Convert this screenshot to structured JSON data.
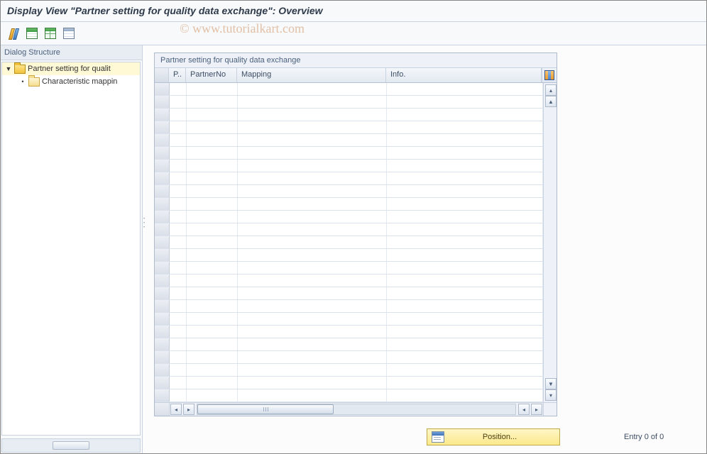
{
  "title": "Display View \"Partner setting for quality data exchange\": Overview",
  "watermark": "© www.tutorialkart.com",
  "toolbar": {
    "buttons": [
      "edit",
      "table-new",
      "table-view",
      "table-settings"
    ]
  },
  "sidebar": {
    "header": "Dialog Structure",
    "nodes": [
      {
        "label": "Partner setting for qualit",
        "open": true,
        "selected": true
      },
      {
        "label": "Characteristic mappin",
        "open": false,
        "selected": false
      }
    ]
  },
  "panel": {
    "title": "Partner setting for quality data exchange",
    "columns": {
      "p": "P..",
      "pn": "PartnerNo",
      "map": "Mapping",
      "info": "Info."
    },
    "row_count": 25
  },
  "footer": {
    "position_label": "Position...",
    "entry_text": "Entry 0 of 0"
  }
}
